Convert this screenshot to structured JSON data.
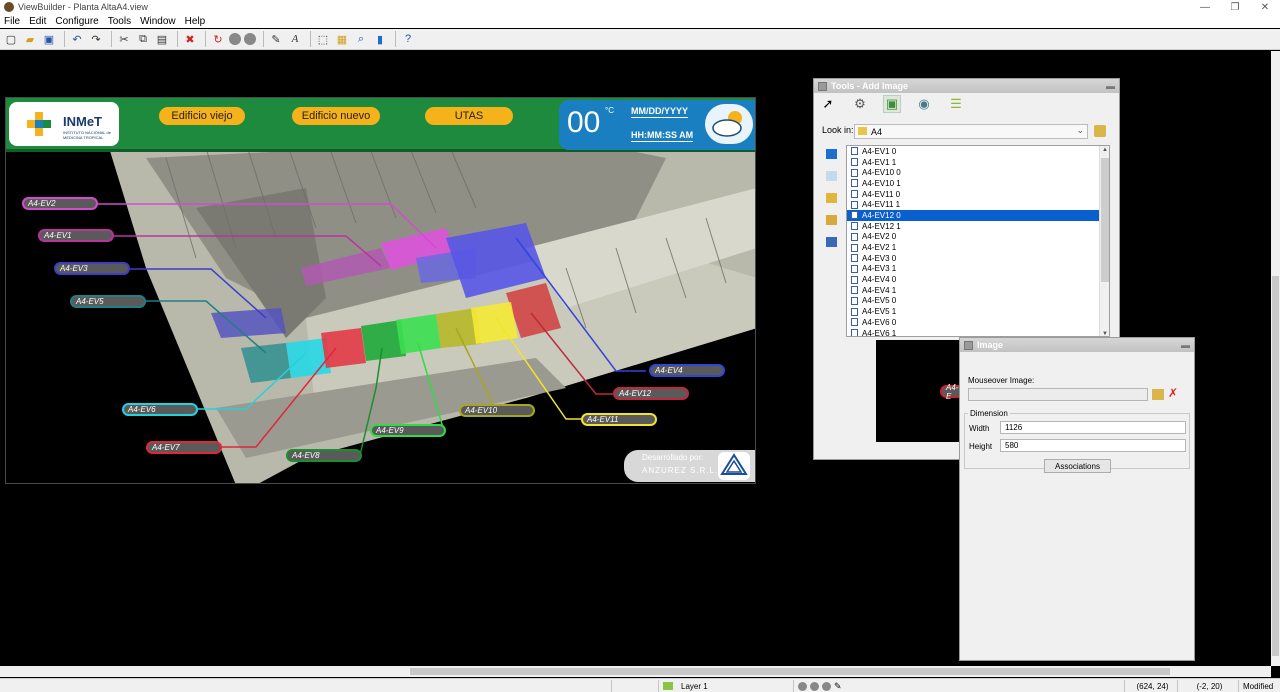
{
  "window": {
    "title": "ViewBuilder - Planta AltaA4.view",
    "min": "—",
    "restore": "❐",
    "close": "✕"
  },
  "menu": [
    "File",
    "Edit",
    "Configure",
    "Tools",
    "Window",
    "Help"
  ],
  "toolbar": {
    "icons": [
      "new-file-icon",
      "open-folder-icon",
      "save-icon",
      "undo-icon",
      "redo-icon",
      "cut-icon",
      "copy-icon",
      "paste-icon",
      "delete-icon",
      "record-icon",
      "stop-icon",
      "pause-icon",
      "wand-icon",
      "text-icon",
      "select-icon",
      "image-icon",
      "zoom-icon",
      "chart-icon",
      "help-icon"
    ]
  },
  "scene": {
    "logo": {
      "name": "INMeT",
      "sub": "INSTITUTO NACIONAL de MEDICINA TROPICAL"
    },
    "buttons": [
      "Edificio viejo",
      "Edificio nuevo",
      "UTAS"
    ],
    "weather": {
      "temp": "00",
      "unit": "°C",
      "date": "MM/DD/YYYY",
      "time": "HH:MM:SS AM"
    },
    "tags_left": [
      {
        "id": "ev2",
        "label": "A4-EV2",
        "color": "#d24bd2"
      },
      {
        "id": "ev1",
        "label": "A4-EV1",
        "color": "#b8359f"
      },
      {
        "id": "ev3",
        "label": "A4-EV3",
        "color": "#3d3dc7"
      },
      {
        "id": "ev5",
        "label": "A4-EV5",
        "color": "#1f7f86"
      }
    ],
    "tags_bottom": [
      {
        "id": "ev6",
        "label": "A4-EV6",
        "color": "#22d2e0"
      },
      {
        "id": "ev7",
        "label": "A4-EV7",
        "color": "#e2263a"
      },
      {
        "id": "ev8",
        "label": "A4-EV8",
        "color": "#1a8f2e"
      },
      {
        "id": "ev9",
        "label": "A4-EV9",
        "color": "#2fdc46"
      },
      {
        "id": "ev10",
        "label": "A4-EV10",
        "color": "#a6a81c"
      },
      {
        "id": "ev11",
        "label": "A4-EV11",
        "color": "#f0e52a"
      },
      {
        "id": "ev12",
        "label": "A4-EV12",
        "color": "#c0293c"
      },
      {
        "id": "ev4",
        "label": "A4-EV4",
        "color": "#3146d8"
      }
    ],
    "credit": {
      "line1": "Desarrollado por:",
      "line2": "ANZUREZ S.R.L.",
      "mark": "Anzurez"
    }
  },
  "tools_panel": {
    "title": "Tools - Add Image",
    "lookin_label": "Look in:",
    "lookin_value": "A4",
    "files": [
      "A4-EV1 0",
      "A4-EV1 1",
      "A4-EV10 0",
      "A4-EV10 1",
      "A4-EV11 0",
      "A4-EV11 1",
      "A4-EV12 0",
      "A4-EV12 1",
      "A4-EV2 0",
      "A4-EV2 1",
      "A4-EV3 0",
      "A4-EV3 1",
      "A4-EV4 0",
      "A4-EV4 1",
      "A4-EV5 0",
      "A4-EV5 1",
      "A4-EV6 0",
      "A4-EV6 1"
    ],
    "selected": "A4-EV12 0"
  },
  "image_panel": {
    "title": "Image",
    "mouseover_label": "Mouseover Image:",
    "mouseover_value": "",
    "dimension_label": "Dimension",
    "width_label": "Width",
    "width_value": "1126",
    "height_label": "Height",
    "height_value": "580",
    "associations_label": "Associations"
  },
  "preview_tag": "A4-E",
  "status": {
    "layer": "Layer 1",
    "coords": "(624, 24)",
    "offset": "(-2, 20)",
    "state": "Modified"
  }
}
